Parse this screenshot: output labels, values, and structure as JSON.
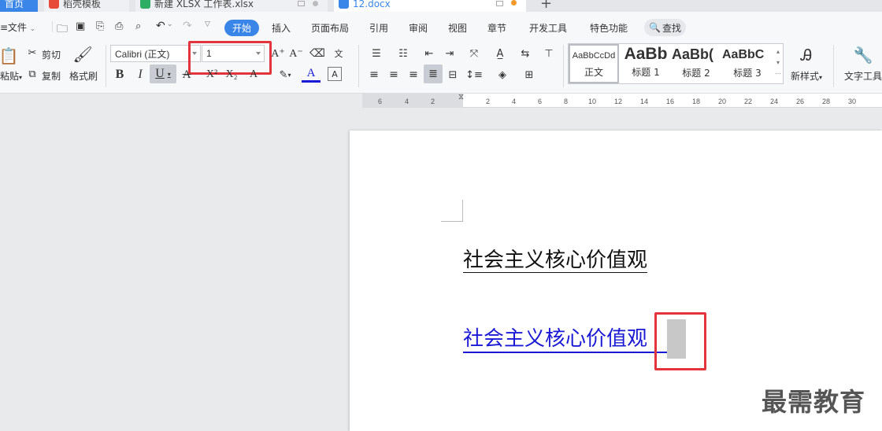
{
  "tabs": [
    {
      "label": "首页",
      "color": "#3a86e8",
      "active": true
    },
    {
      "label": "稻壳模板",
      "color": "#e84a3a"
    },
    {
      "label": "新建 XLSX 工作表.xlsx",
      "color": "#2eae64"
    },
    {
      "label": "12.docx",
      "color": "#3a86e8"
    },
    {
      "label": "+"
    }
  ],
  "menu": {
    "file": "文件",
    "start": "开始",
    "insert": "插入",
    "layout": "页面布局",
    "reference": "引用",
    "review": "审阅",
    "view": "视图",
    "chapter": "章节",
    "dev": "开发工具",
    "special": "特色功能",
    "search": "查找"
  },
  "ribbon": {
    "paste": "粘贴",
    "cut": "剪切",
    "copy": "复制",
    "format_painter": "格式刷",
    "font_name": "Calibri (正文)",
    "font_size": "1",
    "styles": [
      {
        "preview": "AaBbCcDd",
        "label": "正文"
      },
      {
        "preview": "AaBb",
        "label": "标题 1"
      },
      {
        "preview": "AaBb(",
        "label": "标题 2"
      },
      {
        "preview": "AaBbC",
        "label": "标题 3"
      }
    ],
    "new_style": "新样式",
    "text_tools": "文字工具"
  },
  "ruler": [
    "6",
    "4",
    "2",
    "2",
    "4",
    "6",
    "8",
    "10",
    "12",
    "14",
    "16",
    "18",
    "20",
    "22",
    "24",
    "26",
    "28",
    "30"
  ],
  "document": {
    "line1": "社会主义核心价值观",
    "line2": "社会主义核心价值观"
  },
  "watermark": "最需教育",
  "colors": {
    "accent": "#3a86e8",
    "highlight": "#e3343b",
    "hyperlink": "#1a1ad6"
  }
}
